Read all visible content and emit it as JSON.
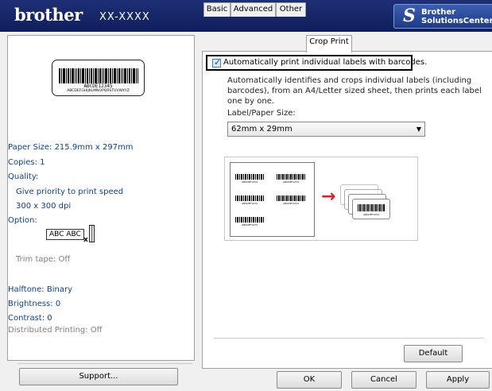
{
  "header": {
    "logo": "brother",
    "model": "XX-XXXX",
    "solutions_line1": "Brother",
    "solutions_line2": "SolutionsCenter"
  },
  "preview": {
    "barcode_number": "ABCDE12345",
    "barcode_text": "ABCDEFGHIJKLMNOPQRSTUVWXYZ"
  },
  "info": {
    "paper_size": "Paper Size: 215.9mm x 297mm",
    "copies": "Copies: 1",
    "quality_label": "Quality:",
    "quality_value": "Give priority to print speed",
    "resolution": "300 x 300 dpi",
    "option_label": "Option:",
    "option_box": "ABC ABC",
    "option_x": "x",
    "trim_tape": "Trim tape: Off",
    "halftone": "Halftone: Binary",
    "brightness": "Brightness:  0",
    "contrast": "Contrast:  0",
    "distributed": "Distributed Printing: Off"
  },
  "buttons": {
    "support": "Support...",
    "default": "Default",
    "ok": "OK",
    "cancel": "Cancel",
    "apply": "Apply"
  },
  "tabs": [
    {
      "label": "Basic"
    },
    {
      "label": "Advanced"
    },
    {
      "label": "Other"
    },
    {
      "label": "Crop Print",
      "active": true
    }
  ],
  "crop_print": {
    "checkbox_label": "Automatically print individual labels with barcodes.",
    "checkbox_checked": true,
    "checkbox_mark": "✓",
    "description": "Automatically identifies and crops individual labels (including barcodes), from an A4/Letter sized sheet, then prints each label one by one.",
    "label_paper_size_label": "Label/Paper Size:",
    "label_paper_size_value": "62mm x 29mm",
    "dropdown_arrow": "▼",
    "illustration_arrow": "→",
    "sample_code": "ABCDEF1234"
  },
  "colors": {
    "header_bg": "#14246a",
    "info_text": "#0b3f98",
    "arrow": "#e02020"
  }
}
